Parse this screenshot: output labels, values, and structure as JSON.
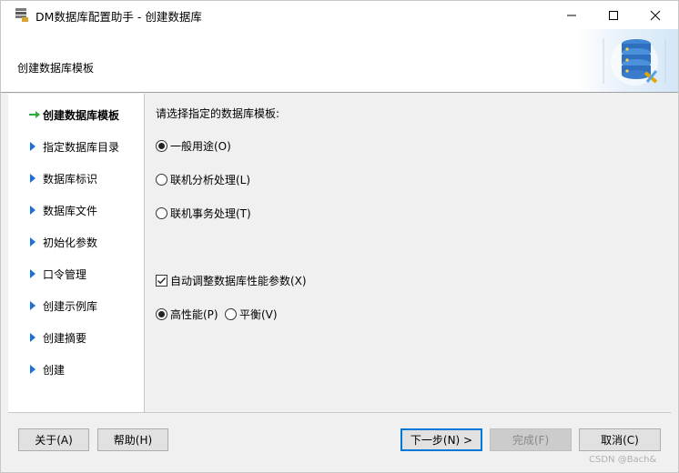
{
  "window": {
    "title": "DM数据库配置助手 - 创建数据库",
    "header_title": "创建数据库模板"
  },
  "nav": {
    "items": [
      {
        "label": "创建数据库模板",
        "active": true
      },
      {
        "label": "指定数据库目录",
        "active": false
      },
      {
        "label": "数据库标识",
        "active": false
      },
      {
        "label": "数据库文件",
        "active": false
      },
      {
        "label": "初始化参数",
        "active": false
      },
      {
        "label": "口令管理",
        "active": false
      },
      {
        "label": "创建示例库",
        "active": false
      },
      {
        "label": "创建摘要",
        "active": false
      },
      {
        "label": "创建",
        "active": false
      }
    ]
  },
  "content": {
    "prompt": "请选择指定的数据库模板:",
    "templates": [
      {
        "label": "一般用途(O)",
        "checked": true
      },
      {
        "label": "联机分析处理(L)",
        "checked": false
      },
      {
        "label": "联机事务处理(T)",
        "checked": false
      }
    ],
    "auto_tune": {
      "label": "自动调整数据库性能参数(X)",
      "checked": true
    },
    "perf": [
      {
        "label": "高性能(P)",
        "checked": true
      },
      {
        "label": "平衡(V)",
        "checked": false
      }
    ]
  },
  "footer": {
    "about": "关于(A)",
    "help": "帮助(H)",
    "next": "下一步(N) >",
    "finish": "完成(F)",
    "cancel": "取消(C)"
  },
  "watermark": "CSDN @Bach&",
  "colors": {
    "active_arrow": "#2eaa3c",
    "nav_arrow": "#1e6fd6",
    "primary_border": "#0078d7"
  }
}
